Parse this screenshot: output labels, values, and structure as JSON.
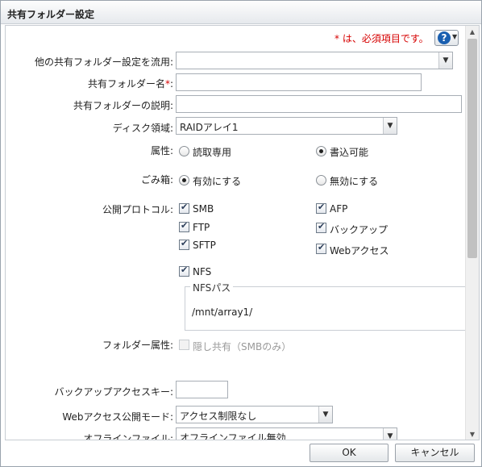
{
  "dialog": {
    "title": "共有フォルダー設定"
  },
  "header": {
    "required_note": "* は、必須項目です。",
    "help_icon": "question-icon"
  },
  "form": {
    "copy_from": {
      "label": "他の共有フォルダー設定を流用:",
      "value": ""
    },
    "name": {
      "label": "共有フォルダー名",
      "required": "*",
      "colon": ":",
      "value": ""
    },
    "description": {
      "label": "共有フォルダーの説明:",
      "value": ""
    },
    "disk": {
      "label": "ディスク領域:",
      "value": "RAIDアレイ1"
    },
    "attribute": {
      "label": "属性:",
      "options": [
        "読取専用",
        "書込可能"
      ],
      "selected": "書込可能"
    },
    "trash": {
      "label": "ごみ箱:",
      "options": [
        "有効にする",
        "無効にする"
      ],
      "selected": "有効にする"
    },
    "protocols": {
      "label": "公開プロトコル:",
      "items": [
        {
          "name": "SMB",
          "checked": true
        },
        {
          "name": "AFP",
          "checked": true
        },
        {
          "name": "FTP",
          "checked": true
        },
        {
          "name": "バックアップ",
          "checked": true
        },
        {
          "name": "SFTP",
          "checked": true
        },
        {
          "name": "Webアクセス",
          "checked": true
        },
        {
          "name": "NFS",
          "checked": true
        }
      ]
    },
    "nfs": {
      "legend": "NFSパス",
      "path": "/mnt/array1/"
    },
    "folder_attr": {
      "label": "フォルダー属性:",
      "option": "隠し共有（SMBのみ）",
      "checked": false,
      "disabled": true
    },
    "backup_key": {
      "label": "バックアップアクセスキー:",
      "value": ""
    },
    "web_mode": {
      "label": "Webアクセス公開モード:",
      "value": "アクセス制限なし"
    },
    "offline": {
      "label": "オフラインファイル:",
      "value": "オフラインファイル無効"
    }
  },
  "buttons": {
    "ok": "OK",
    "cancel": "キャンセル"
  }
}
